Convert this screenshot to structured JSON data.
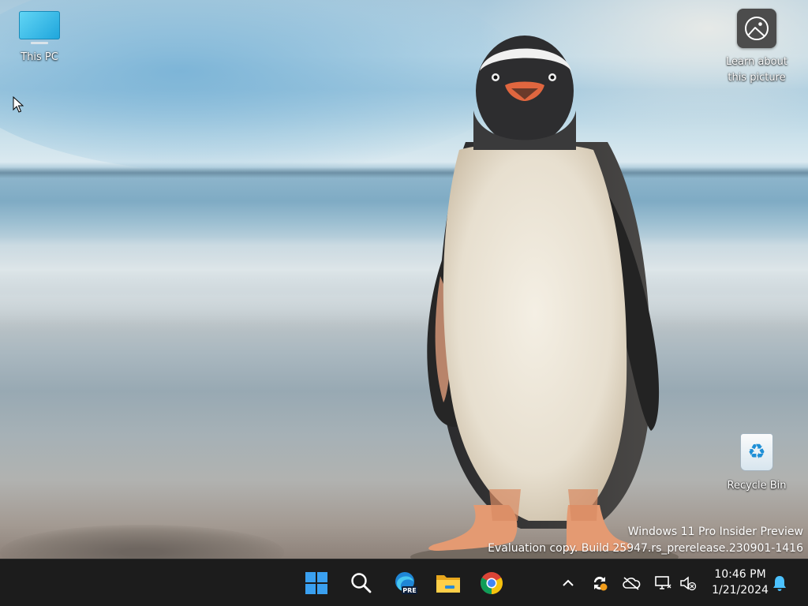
{
  "desktop": {
    "icons": [
      {
        "label": "This PC"
      },
      {
        "label": "Learn about\nthis picture"
      },
      {
        "label": "Recycle Bin"
      }
    ],
    "watermark": {
      "line1": "Windows 11 Pro Insider Preview",
      "line2": "Evaluation copy. Build 25947.rs_prerelease.230901-1416"
    }
  },
  "taskbar": {
    "apps": [
      {
        "name": "start-icon"
      },
      {
        "name": "search-icon"
      },
      {
        "name": "edge-preview-icon",
        "badge": "PRE"
      },
      {
        "name": "file-explorer-icon"
      },
      {
        "name": "chrome-icon"
      }
    ],
    "tray": {
      "icons": [
        "chevron-up-icon",
        "sync-warning-icon",
        "onedrive-offline-icon",
        "network-icon",
        "volume-muted-icon",
        "notifications-icon"
      ]
    },
    "clock": {
      "time": "10:46 PM",
      "date": "1/21/2024"
    }
  },
  "colors": {
    "taskbar_bg": "#1c1c1c",
    "accent_blue": "#3aa0f0",
    "notify_blue": "#4cc2ff"
  }
}
